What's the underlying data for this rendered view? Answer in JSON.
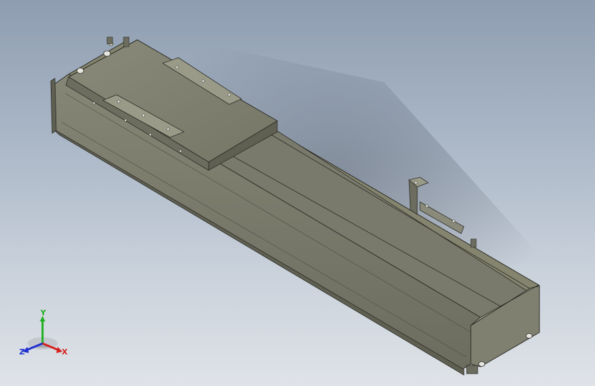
{
  "viewport": {
    "background_top": "#8e9db0",
    "background_bottom": "#dfe3e8"
  },
  "model": {
    "body_color": "#7f7f70",
    "dark_color": "#5f5f52",
    "edge_color": "#2a2a24",
    "highlight_color": "#a9a998"
  },
  "triad": {
    "x_label": "X",
    "y_label": "Y",
    "z_label": "Z",
    "x_color": "#d62020",
    "y_color": "#20b020",
    "z_color": "#2030d0"
  }
}
